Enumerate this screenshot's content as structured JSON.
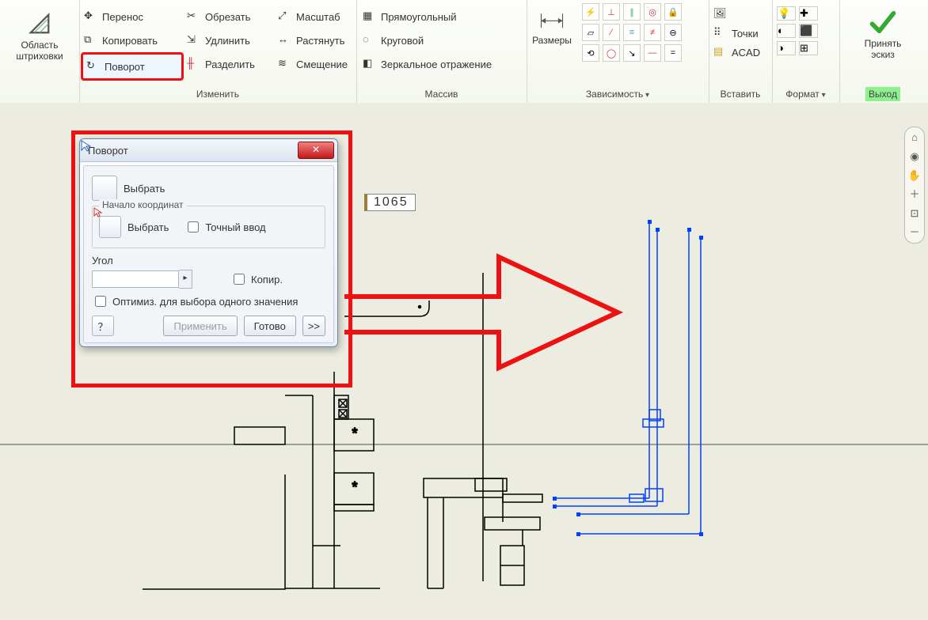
{
  "ribbon": {
    "hatch": {
      "label": "Область\nштриховки"
    },
    "modify": {
      "label": "Изменить",
      "move": "Перенос",
      "copy": "Копировать",
      "rotate": "Поворот",
      "trim": "Обрезать",
      "extend": "Удлинить",
      "split": "Разделить",
      "scale": "Масштаб",
      "stretch": "Растянуть",
      "offset": "Смещение"
    },
    "array": {
      "label": "Массив",
      "rect": "Прямоугольный",
      "circ": "Круговой",
      "mirror": "Зеркальное отражение"
    },
    "dims": {
      "label": "Размеры",
      "dd_label": "Зависимость"
    },
    "insert": {
      "label": "Вставить",
      "points": "Точки",
      "acad": "ACAD"
    },
    "format": {
      "label": "Формат"
    },
    "exit": {
      "label": "Выход",
      "accept": "Принять\nэскиз"
    }
  },
  "dim_value": "1065",
  "dialog": {
    "title": "Поворот",
    "select": "Выбрать",
    "origin_legend": "Начало координат",
    "origin_select": "Выбрать",
    "precise": "Точный ввод",
    "angle": "Угол",
    "copy": "Копир.",
    "optimize": "Оптимиз. для выбора одного значения",
    "apply": "Применить",
    "done": "Готово",
    "more": ">>"
  }
}
